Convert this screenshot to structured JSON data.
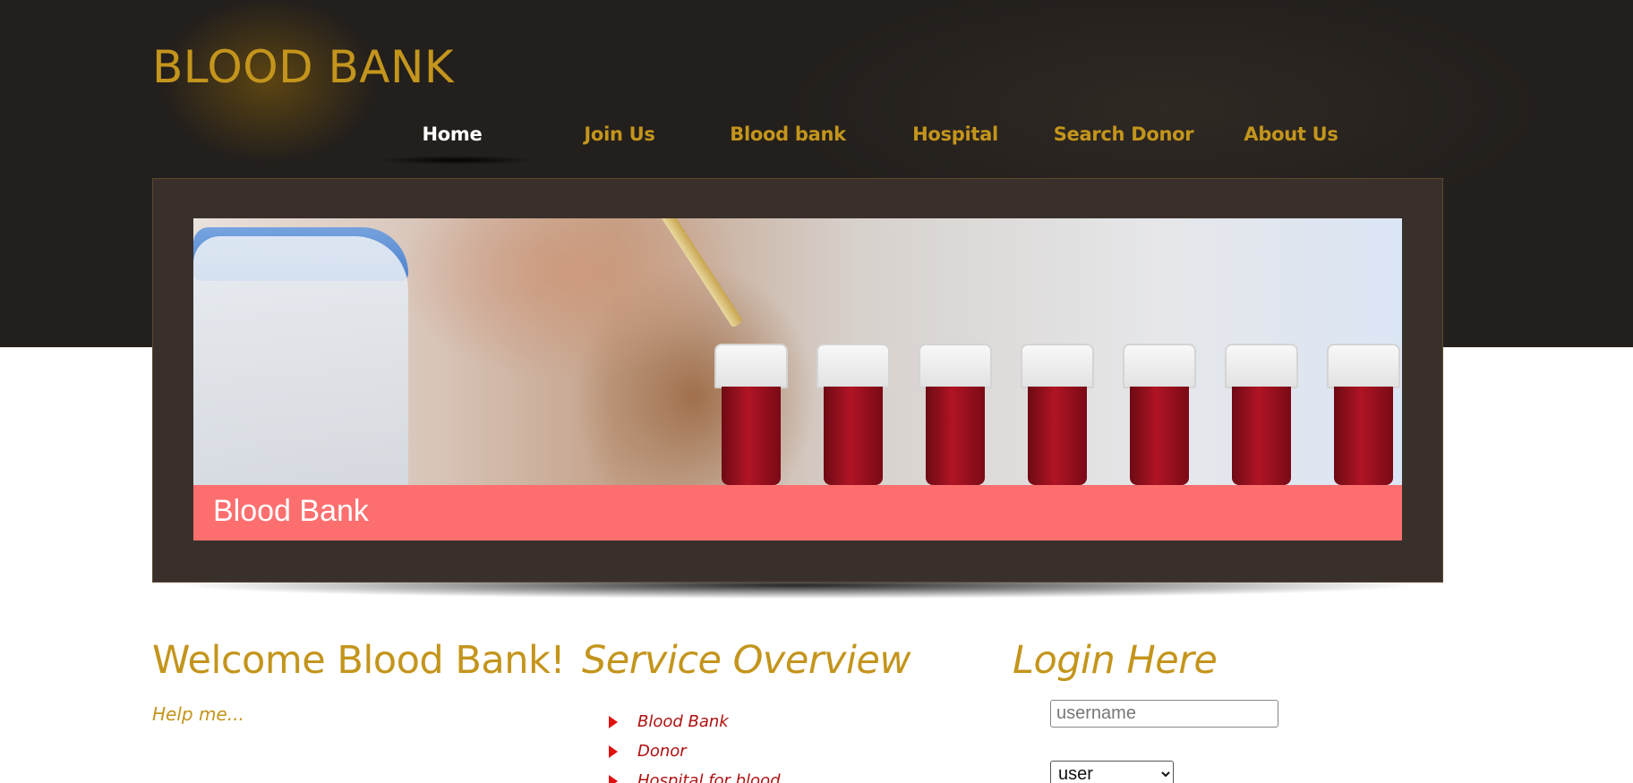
{
  "site": {
    "logo": "BLOOD BANK"
  },
  "nav": {
    "items": [
      {
        "label": "Home",
        "active": true
      },
      {
        "label": "Join Us",
        "active": false
      },
      {
        "label": "Blood bank",
        "active": false
      },
      {
        "label": "Hospital",
        "active": false
      },
      {
        "label": "Search Donor",
        "active": false
      },
      {
        "label": "About Us",
        "active": false
      }
    ]
  },
  "banner": {
    "caption": "Blood Bank"
  },
  "welcome": {
    "title": "Welcome Blood Bank!",
    "text": "Help me..."
  },
  "services": {
    "title": "Service Overview",
    "items": [
      "Blood Bank",
      "Donor",
      "Hospital for blood"
    ]
  },
  "login": {
    "title": "Login Here",
    "username_placeholder": "username",
    "role_selected": "user"
  },
  "colors": {
    "accent": "#c4951c",
    "header_bg": "#231f1c",
    "banner_frame": "#3a302b",
    "caption_bar": "#fd6f6f",
    "service_link": "#b01010"
  }
}
